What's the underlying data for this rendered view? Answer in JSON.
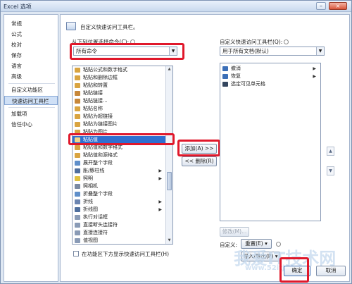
{
  "window": {
    "title": "Excel 选项",
    "minimize": "–",
    "maximize": "□",
    "close": "×"
  },
  "nav": {
    "items": [
      {
        "label": "常规"
      },
      {
        "label": "公式"
      },
      {
        "label": "校对"
      },
      {
        "label": "保存"
      },
      {
        "label": "语言"
      },
      {
        "label": "高级"
      },
      {
        "label": "自定义功能区"
      },
      {
        "label": "快速访问工具栏",
        "active": true
      },
      {
        "label": "加载项"
      },
      {
        "label": "信任中心"
      }
    ]
  },
  "header": {
    "title": "自定义快速访问工具栏。"
  },
  "left": {
    "choose_label": "从下列位置选择命令(C):",
    "choose_value": "所有命令",
    "commands": [
      {
        "label": "粘贴公式和数字格式",
        "icon": "paste-icon"
      },
      {
        "label": "粘贴和删除边框",
        "icon": "paste-icon"
      },
      {
        "label": "粘贴和转置",
        "icon": "paste-icon"
      },
      {
        "label": "粘贴链接",
        "icon": "paste-icon"
      },
      {
        "label": "粘贴链接...",
        "icon": "paste-icon"
      },
      {
        "label": "粘贴名称",
        "icon": "paste-icon"
      },
      {
        "label": "粘贴为超链接",
        "icon": "paste-icon"
      },
      {
        "label": "粘贴为链接图片",
        "icon": "paste-icon"
      },
      {
        "label": "粘贴为图片",
        "icon": "paste-icon"
      },
      {
        "label": "粘贴值",
        "icon": "paste-icon",
        "selected": true
      },
      {
        "label": "粘贴值和数字格式",
        "icon": "paste-icon"
      },
      {
        "label": "粘贴值和源格式",
        "icon": "paste-icon"
      },
      {
        "label": "展开整个字段",
        "icon": "expand-icon"
      },
      {
        "label": "胀/豚柱线",
        "icon": "chart-icon",
        "submenu": "▶"
      },
      {
        "label": "照明",
        "icon": "light-icon",
        "submenu": "▶"
      },
      {
        "label": "照相机",
        "icon": "camera-icon"
      },
      {
        "label": "折叠整个字段",
        "icon": "collapse-icon"
      },
      {
        "label": "折线",
        "icon": "line-icon",
        "submenu": "▶"
      },
      {
        "label": "折线图",
        "icon": "linechart-icon",
        "submenu": "▶"
      },
      {
        "label": "执行对话框",
        "icon": "dialog-icon"
      },
      {
        "label": "直接断头连接符",
        "icon": "connector-icon"
      },
      {
        "label": "直接连接符",
        "icon": "connector-icon"
      },
      {
        "label": "值视图",
        "icon": "view-icon"
      }
    ],
    "checkbox_label": "在功能区下方显示快速访问工具栏(H)"
  },
  "middle": {
    "add_label": "添加(A) >>",
    "remove_label": "<< 删除(R)"
  },
  "right": {
    "customize_label": "自定义快速访问工具栏(Q):",
    "customize_value": "用于所有文档(默认)",
    "items": [
      {
        "label": "撤消",
        "icon": "undo-icon",
        "submenu": "▶"
      },
      {
        "label": "恢复",
        "icon": "redo-icon",
        "submenu": "▶"
      },
      {
        "label": "选定可见单元格",
        "icon": "select-visible-icon"
      }
    ],
    "modify_label": "修改(M)...",
    "customize_text": "自定义:",
    "reset_label": "重置(E) ▾",
    "import_export_label": "导入/导出(P) ▾"
  },
  "footer": {
    "ok_label": "确定",
    "cancel_label": "取消"
  },
  "watermark": {
    "text": "我爱IT技术网",
    "url": "www.52itjs.com"
  },
  "colors": {
    "highlight": "#e0182b",
    "selection": "#2f6fd0",
    "accent": "#cfe0f6"
  }
}
